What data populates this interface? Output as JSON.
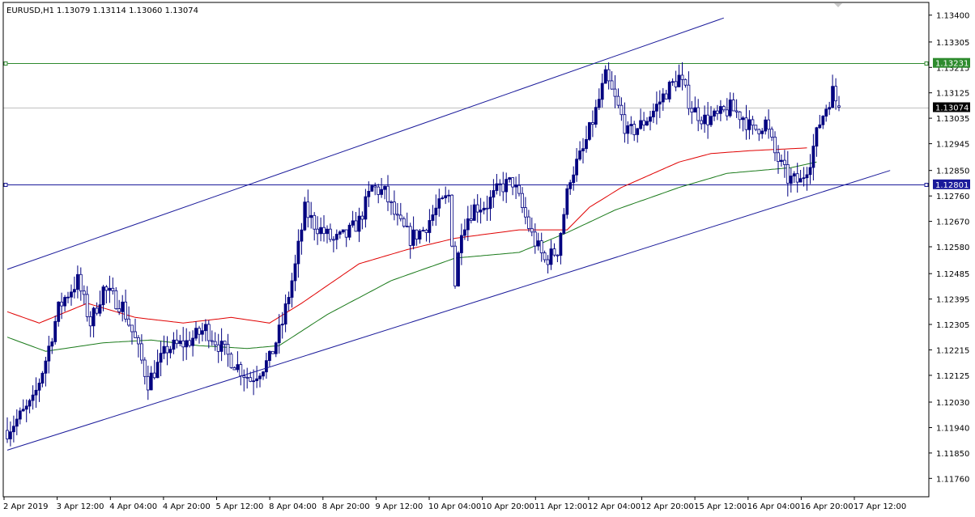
{
  "header": {
    "symbol_text": "EURUSD,H1",
    "ohlc_text": "1.13079 1.13114 1.13060 1.13074"
  },
  "colors": {
    "background": "#ffffff",
    "frame": "#000000",
    "candle": "#000080",
    "channel": "#1a1a9a",
    "resistance": "#2e8b2e",
    "support": "#1a1a9a",
    "ma_fast": "#e00000",
    "ma_slow": "#1a7a1a",
    "price_line": "#c0c0c0"
  },
  "chart_data": {
    "type": "candlestick",
    "symbol": "EURUSD",
    "timeframe": "H1",
    "current": {
      "open": 1.13079,
      "high": 1.13114,
      "low": 1.1306,
      "close": 1.13074
    },
    "y_range": [
      1.11695,
      1.13445
    ],
    "y_tick_labels": [
      "1.13400",
      "1.13305",
      "1.13215",
      "1.13125",
      "1.13035",
      "1.12945",
      "1.12850",
      "1.12760",
      "1.12670",
      "1.12580",
      "1.12485",
      "1.12395",
      "1.12305",
      "1.12215",
      "1.12125",
      "1.12030",
      "1.11940",
      "1.11850",
      "1.11760"
    ],
    "x_tick_labels": [
      "2 Apr 2019",
      "3 Apr 12:00",
      "4 Apr 04:00",
      "4 Apr 20:00",
      "5 Apr 12:00",
      "8 Apr 04:00",
      "8 Apr 20:00",
      "9 Apr 12:00",
      "10 Apr 04:00",
      "10 Apr 20:00",
      "11 Apr 12:00",
      "12 Apr 04:00",
      "12 Apr 20:00",
      "15 Apr 12:00",
      "16 Apr 04:00",
      "16 Apr 20:00",
      "17 Apr 12:00"
    ],
    "horizontal_lines": [
      {
        "name": "resistance",
        "value": 1.13231,
        "label": "1.13231"
      },
      {
        "name": "support",
        "value": 1.12801,
        "label": "1.12801"
      },
      {
        "name": "current-price",
        "value": 1.13074,
        "label": "1.13074"
      }
    ],
    "channel": {
      "upper": [
        [
          0,
          1.125
        ],
        [
          224,
          1.1339
        ]
      ],
      "lower": [
        [
          0,
          1.1186
        ],
        [
          276,
          1.1285
        ]
      ]
    },
    "ma_fast_control": [
      [
        0,
        1.1235
      ],
      [
        10,
        1.1231
      ],
      [
        25,
        1.1238
      ],
      [
        40,
        1.1233
      ],
      [
        55,
        1.1231
      ],
      [
        70,
        1.1233
      ],
      [
        82,
        1.1231
      ],
      [
        92,
        1.1238
      ],
      [
        110,
        1.1252
      ],
      [
        125,
        1.1257
      ],
      [
        140,
        1.1261
      ],
      [
        160,
        1.1264
      ],
      [
        175,
        1.1264
      ],
      [
        182,
        1.1272
      ],
      [
        192,
        1.1279
      ],
      [
        210,
        1.1288
      ],
      [
        220,
        1.1291
      ],
      [
        232,
        1.1292
      ],
      [
        250,
        1.1293
      ]
    ],
    "ma_slow_control": [
      [
        0,
        1.1226
      ],
      [
        12,
        1.1221
      ],
      [
        30,
        1.1224
      ],
      [
        45,
        1.1225
      ],
      [
        60,
        1.1223
      ],
      [
        75,
        1.1222
      ],
      [
        85,
        1.1223
      ],
      [
        100,
        1.1234
      ],
      [
        120,
        1.1246
      ],
      [
        140,
        1.1254
      ],
      [
        160,
        1.1256
      ],
      [
        175,
        1.1263
      ],
      [
        190,
        1.1271
      ],
      [
        210,
        1.1279
      ],
      [
        225,
        1.1284
      ],
      [
        235,
        1.1285
      ],
      [
        245,
        1.1286
      ],
      [
        253,
        1.1288
      ]
    ],
    "price_anchors": [
      [
        0,
        1.1193
      ],
      [
        8,
        1.1203
      ],
      [
        12,
        1.1218
      ],
      [
        16,
        1.1236
      ],
      [
        18,
        1.124
      ],
      [
        22,
        1.1246
      ],
      [
        26,
        1.1231
      ],
      [
        30,
        1.1243
      ],
      [
        36,
        1.1237
      ],
      [
        40,
        1.1225
      ],
      [
        44,
        1.121
      ],
      [
        50,
        1.1222
      ],
      [
        56,
        1.1224
      ],
      [
        62,
        1.1229
      ],
      [
        70,
        1.1218
      ],
      [
        76,
        1.1211
      ],
      [
        82,
        1.1218
      ],
      [
        86,
        1.1231
      ],
      [
        90,
        1.1251
      ],
      [
        93,
        1.1271
      ],
      [
        96,
        1.1266
      ],
      [
        102,
        1.126
      ],
      [
        106,
        1.1262
      ],
      [
        110,
        1.1267
      ],
      [
        114,
        1.1279
      ],
      [
        118,
        1.1277
      ],
      [
        122,
        1.1267
      ],
      [
        126,
        1.1261
      ],
      [
        130,
        1.1264
      ],
      [
        134,
        1.1271
      ],
      [
        138,
        1.1276
      ],
      [
        140,
        1.1245
      ],
      [
        142,
        1.1265
      ],
      [
        146,
        1.1272
      ],
      [
        150,
        1.1273
      ],
      [
        154,
        1.1279
      ],
      [
        158,
        1.1281
      ],
      [
        164,
        1.1262
      ],
      [
        168,
        1.1253
      ],
      [
        172,
        1.1257
      ],
      [
        176,
        1.1283
      ],
      [
        180,
        1.1292
      ],
      [
        184,
        1.1306
      ],
      [
        187,
        1.1318
      ],
      [
        190,
        1.131
      ],
      [
        194,
        1.1298
      ],
      [
        198,
        1.1301
      ],
      [
        202,
        1.1306
      ],
      [
        206,
        1.1313
      ],
      [
        210,
        1.1318
      ],
      [
        214,
        1.1307
      ],
      [
        218,
        1.1303
      ],
      [
        222,
        1.1304
      ],
      [
        226,
        1.1307
      ],
      [
        230,
        1.1304
      ],
      [
        233,
        1.1299
      ],
      [
        237,
        1.1302
      ],
      [
        240,
        1.1291
      ],
      [
        244,
        1.1282
      ],
      [
        248,
        1.1281
      ],
      [
        251,
        1.1289
      ],
      [
        254,
        1.1302
      ],
      [
        258,
        1.1313
      ],
      [
        260,
        1.1307
      ]
    ],
    "bars_count": 261
  }
}
